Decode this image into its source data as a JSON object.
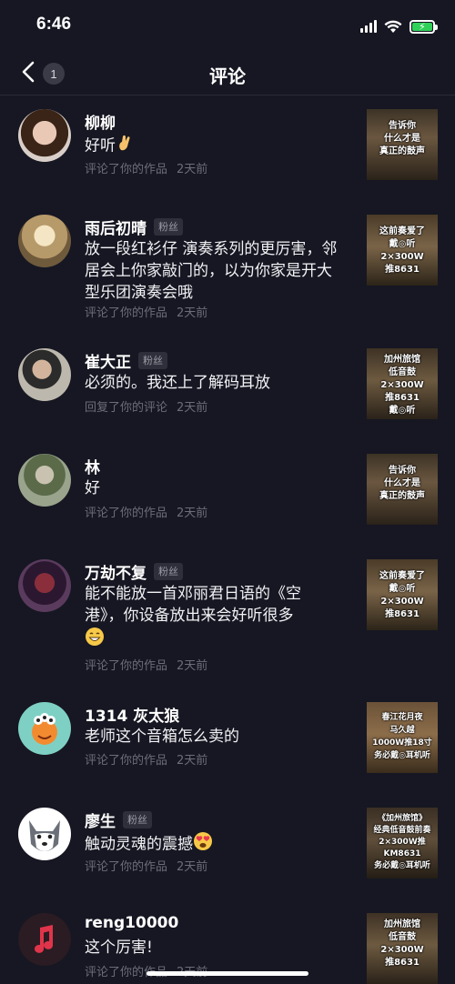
{
  "status": {
    "time": "6:46"
  },
  "header": {
    "title": "评论",
    "unread_count": "1"
  },
  "comments": [
    {
      "user": "柳柳",
      "fan": "",
      "text": "好听",
      "emoji": "pinch-hand",
      "action": "评论了你的作品",
      "time": "2天前",
      "thumb": "告诉你\n什么才是\n真正的鼓声"
    },
    {
      "user": "雨后初晴",
      "fan": "粉丝",
      "text": "放一段红衫仔 演奏系列的更厉害，邻居会上你家敲门的，以为你家是开大型乐团演奏会哦",
      "emoji": "",
      "action": "评论了你的作品",
      "time": "2天前",
      "thumb": "这前奏爱了\n戴◎听\n2×300W\n推8631"
    },
    {
      "user": "崔大正",
      "fan": "粉丝",
      "text": "必须的。我还上了解码耳放",
      "emoji": "",
      "action": "回复了你的评论",
      "time": "2天前",
      "thumb": "加州旅馆\n低音鼓\n2×300W\n推8631\n戴◎听"
    },
    {
      "user": "林",
      "fan": "",
      "text": "好",
      "emoji": "",
      "action": "评论了你的作品",
      "time": "2天前",
      "thumb": "告诉你\n什么才是\n真正的鼓声"
    },
    {
      "user": "万劫不复",
      "fan": "粉丝",
      "text": "能不能放一首邓丽君日语的《空港》，你设备放出来会好听很多",
      "emoji": "grin-face",
      "action": "评论了你的作品",
      "time": "2天前",
      "thumb": "这前奏爱了\n戴◎听\n2×300W\n推8631"
    },
    {
      "user": "1314 灰太狼",
      "fan": "",
      "text": "老师这个音箱怎么卖的",
      "emoji": "",
      "action": "评论了你的作品",
      "time": "2天前",
      "thumb": "春江花月夜\n马久越\n1000W推18寸\n务必戴◎耳机听"
    },
    {
      "user": "廖生",
      "fan": "粉丝",
      "text": "触动灵魂的震撼",
      "emoji": "heart-eyes-face",
      "action": "评论了你的作品",
      "time": "2天前",
      "thumb": "《加州旅馆》\n经典低音鼓前奏\n2×300W推KM8631\n务必戴◎耳机听"
    },
    {
      "user": "reng10000",
      "fan": "",
      "text": "这个厉害!",
      "emoji": "",
      "action": "评论了你的作品",
      "time": "2天前",
      "thumb": "加州旅馆\n低音鼓\n2×300W\n推8631"
    }
  ],
  "colors": {
    "background": "#161722",
    "meta": "#6c6d79",
    "battery": "#30d158"
  }
}
